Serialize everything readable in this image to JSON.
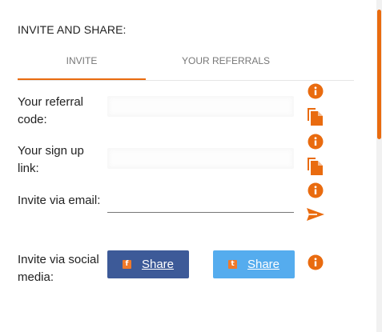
{
  "panel": {
    "title": "INVITE AND SHARE:"
  },
  "tabs": [
    {
      "label": "INVITE",
      "active": true
    },
    {
      "label": "YOUR REFERRALS",
      "active": false
    }
  ],
  "rows": {
    "referral_code": {
      "label": "Your referral code:"
    },
    "sign_up_link": {
      "label": "Your sign up link:"
    },
    "invite_email": {
      "label": "Invite via email:",
      "value": "",
      "placeholder": ""
    },
    "social": {
      "label": "Invite via social media:",
      "facebook": {
        "label": "Share",
        "badge": "f"
      },
      "twitter": {
        "label": "Share",
        "badge": "t"
      }
    }
  },
  "icons": {
    "info": "info-icon",
    "copy": "copy-icon",
    "send": "send-icon"
  },
  "colors": {
    "accent": "#e96b0f",
    "facebook": "#3d5a98",
    "twitter": "#55acee"
  }
}
